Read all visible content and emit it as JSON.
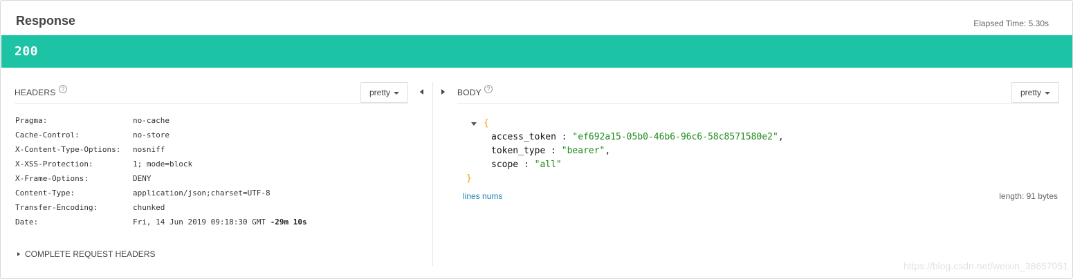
{
  "response": {
    "title": "Response",
    "elapsed_label": "Elapsed Time: 5.30s",
    "status_code": "200",
    "status_color": "#1cc3a4"
  },
  "headers_panel": {
    "label": "HEADERS",
    "help_icon": "?",
    "format_button": "pretty",
    "rows": [
      {
        "name": "Pragma:",
        "value": "no-cache"
      },
      {
        "name": "Cache-Control:",
        "value": "no-store"
      },
      {
        "name": "X-Content-Type-Options:",
        "value": "nosniff"
      },
      {
        "name": "X-XSS-Protection:",
        "value": "1; mode=block"
      },
      {
        "name": "X-Frame-Options:",
        "value": "DENY"
      },
      {
        "name": "Content-Type:",
        "value": "application/json;charset=UTF-8"
      },
      {
        "name": "Transfer-Encoding:",
        "value": "chunked"
      },
      {
        "name": "Date:",
        "value": "Fri, 14 Jun 2019 09:18:30 GMT",
        "value_extra": "-29m 10s"
      }
    ],
    "complete_request_headers": "COMPLETE REQUEST HEADERS"
  },
  "body_panel": {
    "label": "BODY",
    "help_icon": "?",
    "format_button": "pretty",
    "json": {
      "open_brace": "{",
      "close_brace": "}",
      "lines": [
        {
          "key": "access_token",
          "value": "\"ef692a15-05b0-46b6-96c6-58c8571580e2\"",
          "trail": ","
        },
        {
          "key": "token_type",
          "value": "\"bearer\"",
          "trail": ","
        },
        {
          "key": "scope",
          "value": "\"all\"",
          "trail": ""
        }
      ]
    },
    "lines_nums_link": "lines nums",
    "length_label": "length: 91 bytes"
  },
  "watermark": "https://blog.csdn.net/weixin_38657051",
  "icons": {
    "collapse_left": "triangle-left-icon",
    "expand_right": "triangle-right-icon",
    "dropdown": "caret-down-icon",
    "help": "question-circle-icon",
    "json_toggle": "caret-down-icon"
  }
}
